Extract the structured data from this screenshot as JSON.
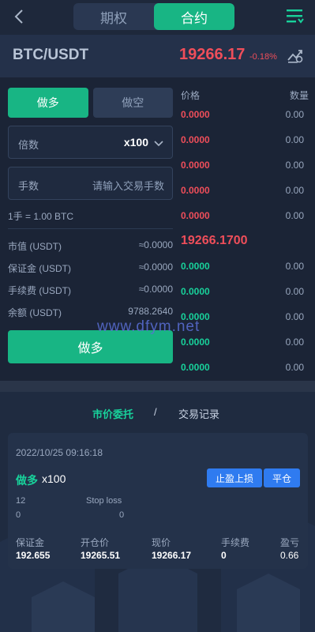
{
  "header": {
    "tabs": [
      {
        "label": "期权"
      },
      {
        "label": "合约"
      }
    ],
    "active_tab": "合约"
  },
  "ticker": {
    "symbol": "BTC/USDT",
    "price": "19266.17",
    "change": "-0.18%"
  },
  "order_form": {
    "long_label": "做多",
    "short_label": "做空",
    "leverage_label": "倍数",
    "leverage_value": "x100",
    "qty_label": "手数",
    "qty_placeholder": "请输入交易手数",
    "lot_info": "1手 = 1.00 BTC",
    "rows": [
      {
        "label": "市值 (USDT)",
        "value": "≈0.0000"
      },
      {
        "label": "保证金 (USDT)",
        "value": "≈0.0000"
      },
      {
        "label": "手续费 (USDT)",
        "value": "≈0.0000"
      },
      {
        "label": "余额 (USDT)",
        "value": "9788.2640"
      }
    ],
    "submit_label": "做多"
  },
  "book": {
    "price_header": "价格",
    "qty_header": "数量",
    "asks": [
      {
        "price": "0.0000",
        "qty": "0.00"
      },
      {
        "price": "0.0000",
        "qty": "0.00"
      },
      {
        "price": "0.0000",
        "qty": "0.00"
      },
      {
        "price": "0.0000",
        "qty": "0.00"
      },
      {
        "price": "0.0000",
        "qty": "0.00"
      }
    ],
    "mid_price": "19266.1700",
    "bids": [
      {
        "price": "0.0000",
        "qty": "0.00"
      },
      {
        "price": "0.0000",
        "qty": "0.00"
      },
      {
        "price": "0.0000",
        "qty": "0.00"
      },
      {
        "price": "0.0000",
        "qty": "0.00"
      },
      {
        "price": "0.0000",
        "qty": "0.00"
      }
    ]
  },
  "watermark": "www.dfym.net",
  "records": {
    "tab_active": "市价委托",
    "tab_sep": "/",
    "tab_other": "交易记录",
    "card": {
      "date": "2022/10/25 09:16:18",
      "direction": "做多",
      "leverage": "x100",
      "btn_tpsl": "止盈上损",
      "btn_close": "平仓",
      "tp_value": "12",
      "sl_label": "Stop loss",
      "tp_sub": "0",
      "sl_sub": "0",
      "labels": [
        "保证金",
        "开仓价",
        "现价",
        "手续费",
        "盈亏"
      ],
      "values": [
        "192.655",
        "19265.51",
        "19266.17",
        "0",
        "0.66"
      ]
    }
  },
  "colors": {
    "green": "#18b584",
    "red": "#ef4e5a",
    "blue": "#2f7bf0"
  }
}
